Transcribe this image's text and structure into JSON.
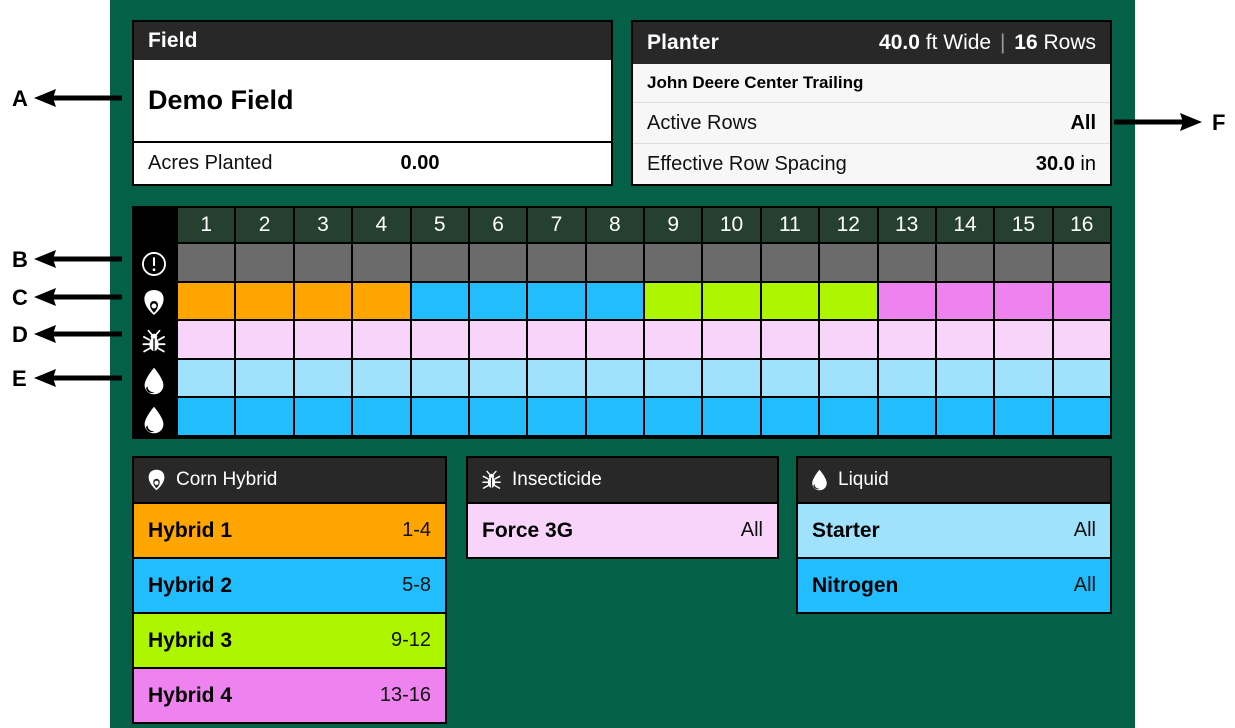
{
  "theme": {
    "background": "#056048",
    "panel_header": "#282828",
    "grid_header_cell": "#26402F",
    "grid_border": "#000000"
  },
  "field": {
    "header_title": "Field",
    "name": "Demo Field",
    "acres_label": "Acres Planted",
    "acres_value": "0.00"
  },
  "planter": {
    "header_title": "Planter",
    "width_value": "40.0",
    "width_unit": "ft Wide",
    "separator": "|",
    "rows_value": "16",
    "rows_unit": "Rows",
    "model": "John Deere Center Trailing",
    "rows": [
      {
        "label": "Active Rows",
        "value": "All",
        "unit": ""
      },
      {
        "label": "Effective Row Spacing",
        "value": "30.0",
        "unit": "in"
      }
    ]
  },
  "row_grid": {
    "column_headers": [
      "1",
      "2",
      "3",
      "4",
      "5",
      "6",
      "7",
      "8",
      "9",
      "10",
      "11",
      "12",
      "13",
      "14",
      "15",
      "16"
    ],
    "row_icons": [
      "alert-icon",
      "corn-seed-icon",
      "bug-icon",
      "liquid-drop-icon",
      "liquid-drop-icon"
    ],
    "rows": [
      {
        "name": "alert-row",
        "colors": [
          "#6B6B6B",
          "#6B6B6B",
          "#6B6B6B",
          "#6B6B6B",
          "#6B6B6B",
          "#6B6B6B",
          "#6B6B6B",
          "#6B6B6B",
          "#6B6B6B",
          "#6B6B6B",
          "#6B6B6B",
          "#6B6B6B",
          "#6B6B6B",
          "#6B6B6B",
          "#6B6B6B",
          "#6B6B6B"
        ]
      },
      {
        "name": "corn-hybrid-row",
        "colors": [
          "#FFA500",
          "#FFA500",
          "#FFA500",
          "#FFA500",
          "#21BDFC",
          "#21BDFC",
          "#21BDFC",
          "#21BDFC",
          "#AEF500",
          "#AEF500",
          "#AEF500",
          "#AEF500",
          "#EE82EE",
          "#EE82EE",
          "#EE82EE",
          "#EE82EE"
        ]
      },
      {
        "name": "insecticide-row",
        "colors": [
          "#F8D4FB",
          "#F8D4FB",
          "#F8D4FB",
          "#F8D4FB",
          "#F8D4FB",
          "#F8D4FB",
          "#F8D4FB",
          "#F8D4FB",
          "#F8D4FB",
          "#F8D4FB",
          "#F8D4FB",
          "#F8D4FB",
          "#F8D4FB",
          "#F8D4FB",
          "#F8D4FB",
          "#F8D4FB"
        ]
      },
      {
        "name": "starter-liquid-row",
        "colors": [
          "#A0E2FB",
          "#A0E2FB",
          "#A0E2FB",
          "#A0E2FB",
          "#A0E2FB",
          "#A0E2FB",
          "#A0E2FB",
          "#A0E2FB",
          "#A0E2FB",
          "#A0E2FB",
          "#A0E2FB",
          "#A0E2FB",
          "#A0E2FB",
          "#A0E2FB",
          "#A0E2FB",
          "#A0E2FB"
        ]
      },
      {
        "name": "nitrogen-liquid-row",
        "colors": [
          "#21BDFC",
          "#21BDFC",
          "#21BDFC",
          "#21BDFC",
          "#21BDFC",
          "#21BDFC",
          "#21BDFC",
          "#21BDFC",
          "#21BDFC",
          "#21BDFC",
          "#21BDFC",
          "#21BDFC",
          "#21BDFC",
          "#21BDFC",
          "#21BDFC",
          "#21BDFC"
        ]
      }
    ]
  },
  "legends": {
    "corn_hybrid": {
      "icon": "corn-seed-icon",
      "title": "Corn Hybrid",
      "items": [
        {
          "name": "Hybrid 1",
          "range": "1-4",
          "color": "#FFA500"
        },
        {
          "name": "Hybrid 2",
          "range": "5-8",
          "color": "#21BDFC"
        },
        {
          "name": "Hybrid 3",
          "range": "9-12",
          "color": "#AEF500"
        },
        {
          "name": "Hybrid 4",
          "range": "13-16",
          "color": "#EE82EE"
        }
      ]
    },
    "insecticide": {
      "icon": "bug-icon",
      "title": "Insecticide",
      "items": [
        {
          "name": "Force 3G",
          "range": "All",
          "color": "#F8D4FB"
        }
      ]
    },
    "liquid": {
      "icon": "liquid-drop-icon",
      "title": "Liquid",
      "items": [
        {
          "name": "Starter",
          "range": "All",
          "color": "#A0E2FB"
        },
        {
          "name": "Nitrogen",
          "range": "All",
          "color": "#21BDFC"
        }
      ]
    }
  },
  "annotations": [
    {
      "letter": "A",
      "direction": "left"
    },
    {
      "letter": "B",
      "direction": "left"
    },
    {
      "letter": "C",
      "direction": "left"
    },
    {
      "letter": "D",
      "direction": "left"
    },
    {
      "letter": "E",
      "direction": "left"
    },
    {
      "letter": "F",
      "direction": "right"
    }
  ]
}
